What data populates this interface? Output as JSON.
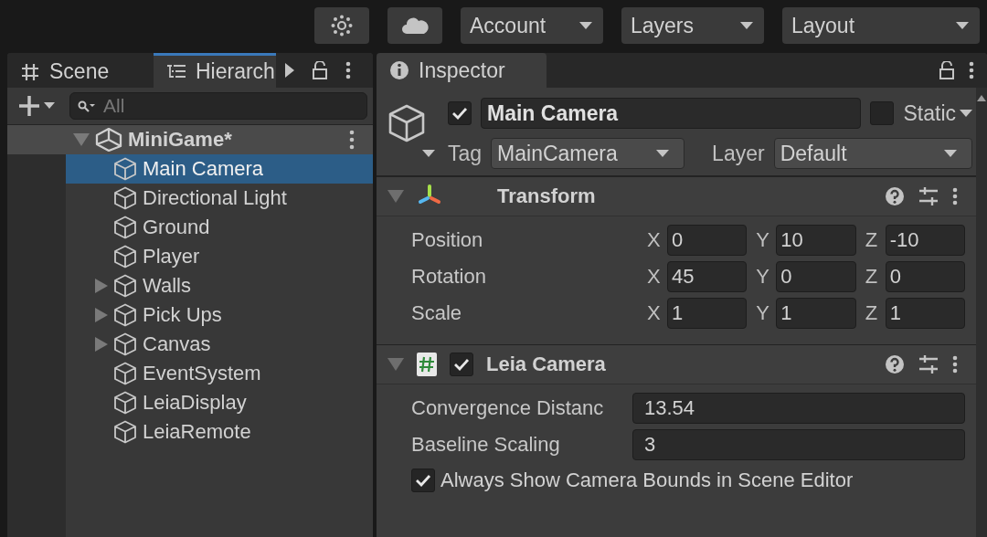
{
  "toolbar": {
    "buttons": [
      {
        "kind": "settings"
      },
      {
        "kind": "cloud"
      }
    ],
    "dropdowns": [
      "Account",
      "Layers",
      "Layout"
    ]
  },
  "left_panel": {
    "tabs": [
      {
        "label": "Scene",
        "kind": "scene",
        "selected": false
      },
      {
        "label": "Hierarch",
        "kind": "hierarchy",
        "selected": true
      }
    ],
    "search": {
      "placeholder": "All"
    },
    "scene": {
      "name": "MiniGame*",
      "expanded": true,
      "children": [
        {
          "name": "Main Camera",
          "kind": "leaf",
          "selected": true
        },
        {
          "name": "Directional Light",
          "kind": "leaf",
          "selected": false
        },
        {
          "name": "Ground",
          "kind": "leaf",
          "selected": false
        },
        {
          "name": "Player",
          "kind": "leaf",
          "selected": false
        },
        {
          "name": "Walls",
          "kind": "parent",
          "selected": false
        },
        {
          "name": "Pick Ups",
          "kind": "parent",
          "selected": false
        },
        {
          "name": "Canvas",
          "kind": "parent",
          "selected": false
        },
        {
          "name": "EventSystem",
          "kind": "leaf",
          "selected": false
        },
        {
          "name": "LeiaDisplay",
          "kind": "leaf",
          "selected": false
        },
        {
          "name": "LeiaRemote",
          "kind": "leaf",
          "selected": false
        }
      ]
    }
  },
  "inspector": {
    "tab": "Inspector",
    "object": {
      "active": true,
      "name": "Main Camera",
      "static": false,
      "static_label": "Static",
      "tag_label": "Tag",
      "tag": "MainCamera",
      "layer_label": "Layer",
      "layer": "Default"
    },
    "transform": {
      "title": "Transform",
      "expanded": true,
      "rows": [
        {
          "label": "Position",
          "values": [
            {
              "axis": "X",
              "value": "0"
            },
            {
              "axis": "Y",
              "value": "10"
            },
            {
              "axis": "Z",
              "value": "-10"
            }
          ]
        },
        {
          "label": "Rotation",
          "values": [
            {
              "axis": "X",
              "value": "45"
            },
            {
              "axis": "Y",
              "value": "0"
            },
            {
              "axis": "Z",
              "value": "0"
            }
          ]
        },
        {
          "label": "Scale",
          "values": [
            {
              "axis": "X",
              "value": "1"
            },
            {
              "axis": "Y",
              "value": "1"
            },
            {
              "axis": "Z",
              "value": "1"
            }
          ]
        }
      ]
    },
    "script": {
      "title": "Leia Camera",
      "enabled": true,
      "expanded": true,
      "fields": [
        {
          "label": "Convergence Distanc",
          "value": "13.54"
        },
        {
          "label": "Baseline Scaling",
          "value": "3"
        }
      ],
      "toggle": {
        "label": "Always Show Camera Bounds in Scene Editor",
        "checked": true
      }
    }
  }
}
